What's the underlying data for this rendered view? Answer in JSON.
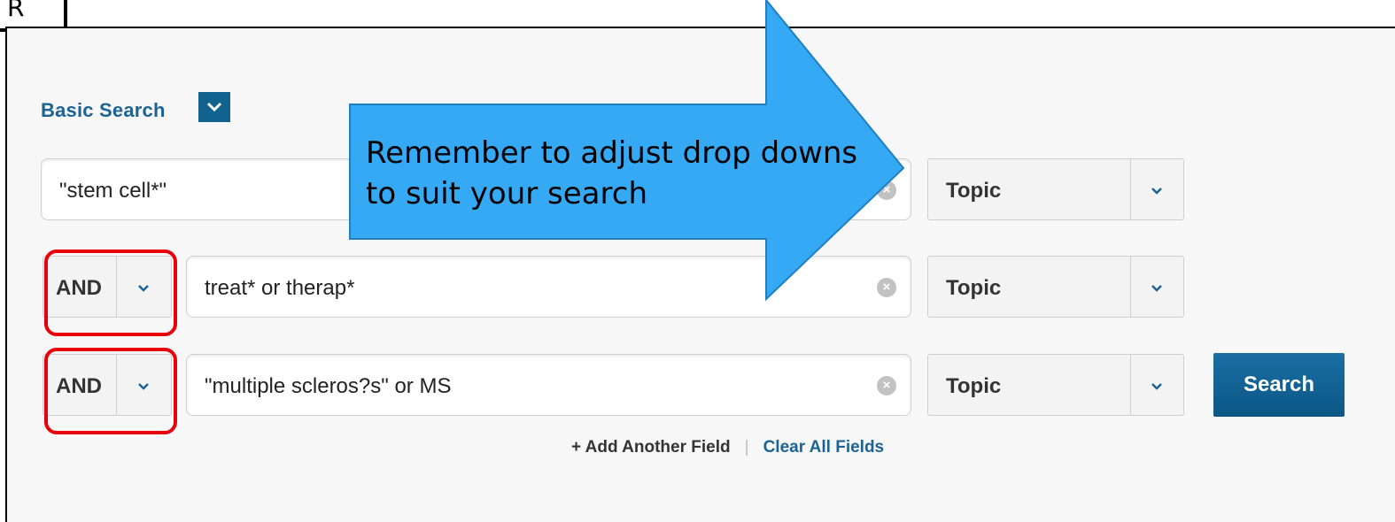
{
  "corner_label": "R",
  "basic_search": {
    "label": "Basic Search"
  },
  "rows": [
    {
      "boolean": null,
      "query": "\"stem cell*\"",
      "field": "Topic"
    },
    {
      "boolean": "AND",
      "query": "treat* or therap*",
      "field": "Topic"
    },
    {
      "boolean": "AND",
      "query": "\"multiple scleros?s\" or MS",
      "field": "Topic"
    }
  ],
  "search_button_label": "Search",
  "links": {
    "add_field": "+ Add Another Field",
    "separator": "|",
    "clear_fields": "Clear All Fields"
  },
  "callout": {
    "text": "Remember to adjust drop downs to suit your search"
  },
  "colors": {
    "accent_blue": "#1c6395",
    "button_blue": "#0b5685",
    "callout_fill": "#36a9f5",
    "highlight_red": "#e8000b"
  },
  "icons": {
    "dropdown": "chevron-down-icon",
    "clear": "clear-x-icon"
  }
}
